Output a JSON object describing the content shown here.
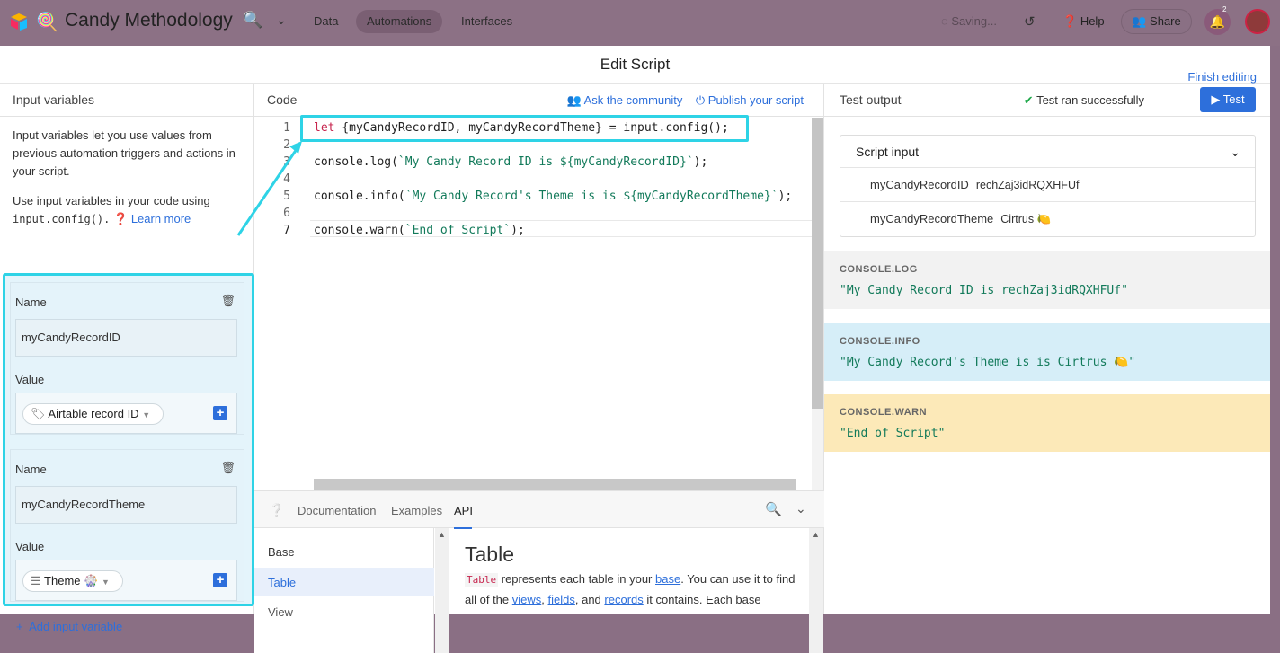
{
  "app": {
    "base_name": "Candy Methodology",
    "base_emoji": "🍭",
    "search_emoji": "🔍",
    "nav": [
      "Data",
      "Automations",
      "Interfaces"
    ],
    "saving": "Saving...",
    "help": "Help",
    "share": "Share",
    "notif_count": "2"
  },
  "modal": {
    "title": "Edit Script",
    "finish": "Finish editing"
  },
  "input_vars": {
    "header": "Input variables",
    "desc1": "Input variables let you use values from previous automation triggers and actions in your script.",
    "desc2_a": "Use input variables in your code using",
    "desc2_code": "input.config().",
    "learn_more": "Learn more",
    "name_label": "Name",
    "value_label": "Value",
    "vars": [
      {
        "name": "myCandyRecordID",
        "value": "Airtable record ID"
      },
      {
        "name": "myCandyRecordTheme",
        "value": "Theme 🎡"
      }
    ],
    "add": "Add input variable"
  },
  "code": {
    "header": "Code",
    "ask": "Ask the community",
    "publish": "Publish your script",
    "line_numbers": [
      "1",
      "2",
      "3",
      "4",
      "5",
      "6",
      "7"
    ],
    "line1_kw": "let",
    "line1_rest": " {myCandyRecordID, myCandyRecordTheme} = input.config();",
    "line3_a": "console.log(",
    "line3_str": "`My Candy Record ID is ${myCandyRecordID}`",
    "line3_b": ");",
    "line5_a": "console.info(",
    "line5_str": "`My Candy Record's Theme is is ${myCandyRecordTheme}`",
    "line5_b": ");",
    "line7_a": "console.warn(",
    "line7_str": "`End of Script`",
    "line7_b": ");"
  },
  "docs": {
    "tabs": [
      "Documentation",
      "Examples",
      "API"
    ],
    "nav": [
      "Base",
      "Table",
      "View"
    ],
    "title": "Table",
    "p_code": "Table",
    "p1": " represents each table in your ",
    "link_base": "base",
    "p2": ". You can use it to find all of the ",
    "link_views": "views",
    "link_fields": "fields",
    "p3": ", and ",
    "link_records": "records",
    "p4": " it contains. Each base"
  },
  "test": {
    "header": "Test output",
    "status": "Test ran successfully",
    "button": "Test",
    "script_input": "Script input",
    "inputs": [
      {
        "key": "myCandyRecordID",
        "value": "rechZaj3idRQXHFUf"
      },
      {
        "key": "myCandyRecordTheme",
        "value": "Cirtrus 🍋"
      }
    ],
    "console": [
      {
        "type": "CONSOLE.LOG",
        "msg": "\"My Candy Record ID is rechZaj3idRQXHFUf\"",
        "bg": "#f2f2f2",
        "color": "#127a5a"
      },
      {
        "type": "CONSOLE.INFO",
        "msg": "\"My Candy Record's Theme is is Cirtrus 🍋\"",
        "bg": "#d6eef8",
        "color": "#127a5a"
      },
      {
        "type": "CONSOLE.WARN",
        "msg": "\"End of Script\"",
        "bg": "#fce9b8",
        "color": "#127a5a"
      }
    ]
  }
}
